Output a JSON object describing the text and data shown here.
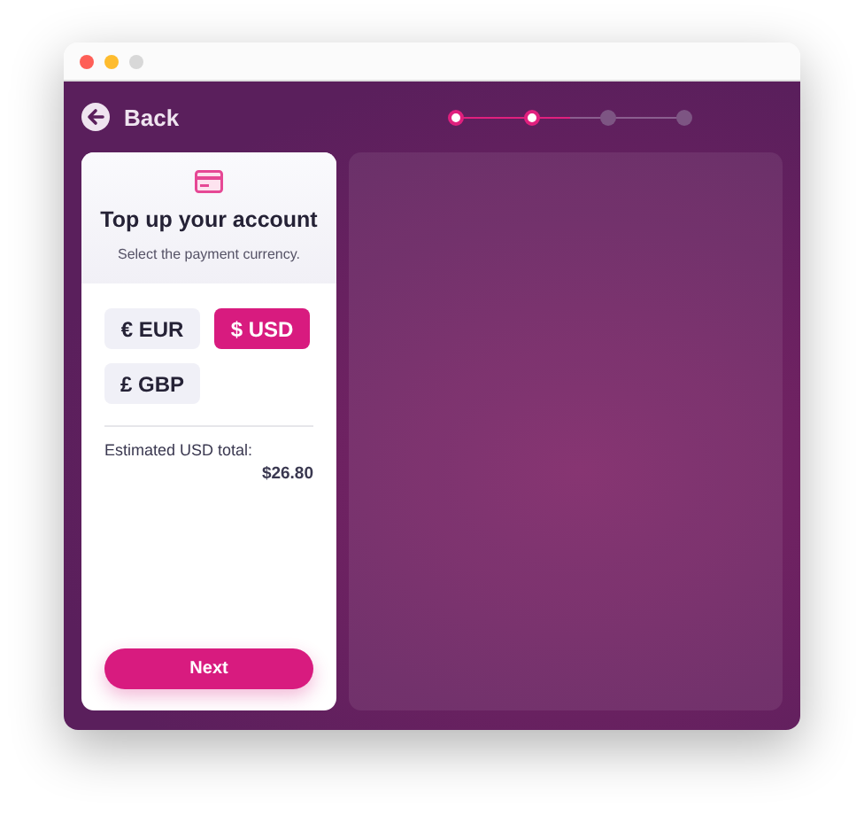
{
  "header": {
    "back_label": "Back"
  },
  "progress": {
    "level": 0.5,
    "steps": [
      {
        "completed": true
      },
      {
        "completed": true
      },
      {
        "completed": false
      },
      {
        "completed": false
      }
    ]
  },
  "card": {
    "title": "Top up your account",
    "subtitle": "Select the payment currency.",
    "currencies": [
      {
        "label": "€ EUR",
        "selected": false
      },
      {
        "label": "$ USD",
        "selected": true
      },
      {
        "label": "£ GBP",
        "selected": false
      }
    ],
    "total_label": "Estimated USD total:",
    "total_value": "$26.80",
    "next_button": "Next"
  }
}
